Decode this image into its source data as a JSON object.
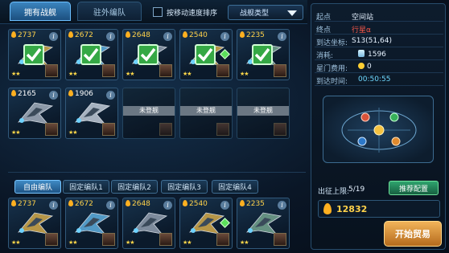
{
  "tabs": {
    "owned": "拥有战舰",
    "outside": "驻外编队"
  },
  "sort_label": "按移动速度排序",
  "type_dropdown": "战舰类型",
  "grid_ships": [
    {
      "cost": "2737",
      "checked": true,
      "stars": "★★"
    },
    {
      "cost": "2672",
      "checked": true,
      "stars": "★★"
    },
    {
      "cost": "2648",
      "checked": true,
      "stars": "★★"
    },
    {
      "cost": "2540",
      "checked": true,
      "stars": "★★"
    },
    {
      "cost": "2235",
      "checked": true,
      "stars": "★★"
    },
    {
      "cost": "2165",
      "checked": false,
      "stars": "★★"
    },
    {
      "cost": "1906",
      "checked": false,
      "stars": "★★"
    }
  ],
  "unbuilt_label": "未登舰",
  "fleet_tabs": [
    "自由编队",
    "固定编队1",
    "固定编队2",
    "固定编队3",
    "固定编队4"
  ],
  "fleet_ships": [
    {
      "cost": "2737",
      "stars": "★★"
    },
    {
      "cost": "2672",
      "stars": "★★"
    },
    {
      "cost": "2648",
      "stars": "★★"
    },
    {
      "cost": "2540",
      "stars": "★★"
    },
    {
      "cost": "2235",
      "stars": "★★"
    }
  ],
  "info": {
    "start_k": "起点",
    "start_v": "空间站",
    "end_k": "终点",
    "end_v": "行星α",
    "coord_k": "到达坐标:",
    "coord_v": "S13(51,64)",
    "cost_k": "消耗:",
    "cost_v": "1596",
    "gate_k": "星门费用:",
    "gate_v": "0",
    "time_k": "到达时间:",
    "time_v": "00:50:55"
  },
  "limit_label": "出征上限:",
  "limit_value": "5/19",
  "recommend_label": "推荐配置",
  "total_power": "12832",
  "start_trade": "开始贸易",
  "colors": {
    "accent": "#3b84be",
    "gold": "#ffd24a",
    "green": "#35a845"
  }
}
